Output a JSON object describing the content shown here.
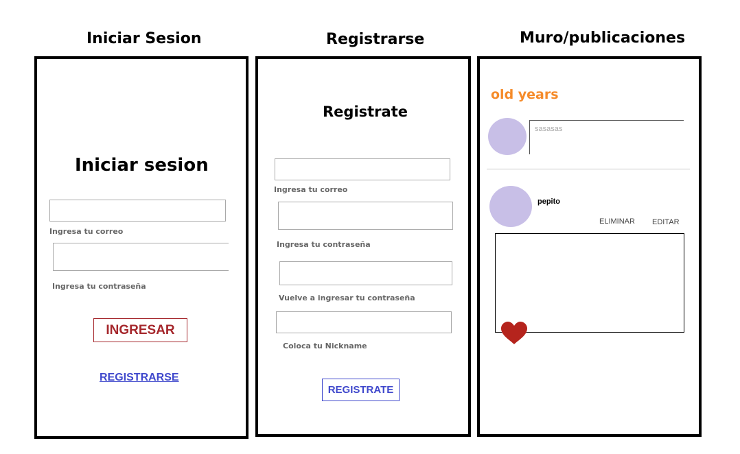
{
  "panels": {
    "login": {
      "title": "Iniciar Sesion",
      "heading": "Iniciar sesion",
      "email_label": "Ingresa tu correo",
      "password_label": "Ingresa tu contraseña",
      "submit_label": "INGRESAR",
      "register_link": "REGISTRARSE"
    },
    "register": {
      "title": "Registrarse",
      "heading": "Registrate",
      "email_label": "Ingresa tu correo",
      "password_label": "Ingresa tu contraseña",
      "repeat_password_label": "Vuelve a ingresar tu contraseña",
      "nickname_label": "Coloca tu Nickname",
      "submit_label": "REGISTRATE"
    },
    "wall": {
      "title": "Muro/publicaciones",
      "username": "old years",
      "composer_text": "sasasas",
      "post": {
        "author": "pepito",
        "delete_label": "ELIMINAR",
        "edit_label": "EDITAR"
      }
    }
  },
  "colors": {
    "accent_orange": "#f58b2a",
    "button_red": "#a5272c",
    "link_blue": "#3f48cc",
    "avatar_purple": "#c8bfe7",
    "heart_red": "#b5241d"
  },
  "icons": {
    "like": "heart-icon"
  }
}
